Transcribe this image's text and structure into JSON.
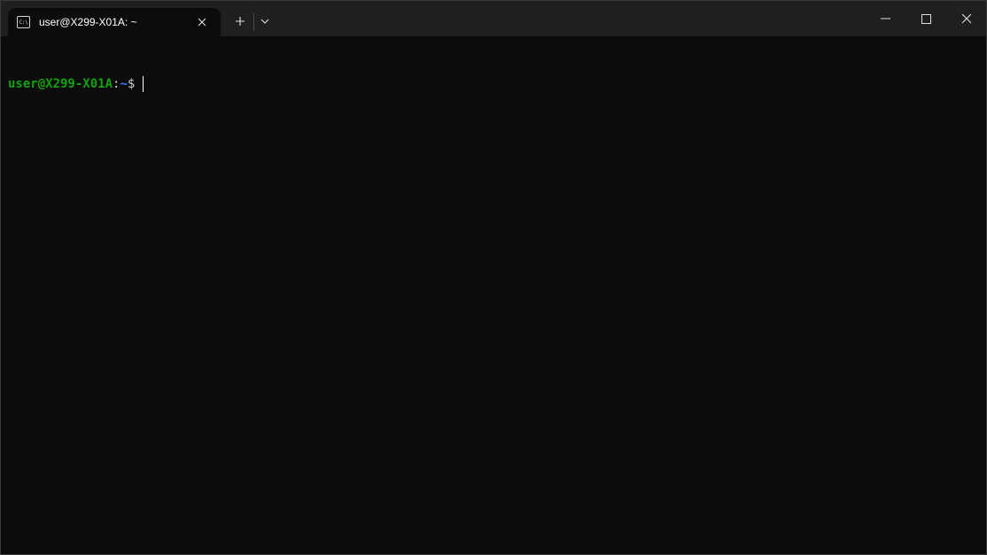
{
  "window": {
    "tab": {
      "title": "user@X299-X01A: ~",
      "icon": "terminal-icon",
      "icon_glyph": "C:\\"
    },
    "controls": {
      "new_tab_icon": "plus-icon",
      "dropdown_icon": "chevron-down-icon",
      "minimize_icon": "minimize-icon",
      "maximize_icon": "maximize-icon",
      "close_icon": "close-icon"
    }
  },
  "terminal": {
    "prompt": {
      "user_host": "user@X299-X01A",
      "colon": ":",
      "path": "~",
      "symbol": "$"
    }
  },
  "colors": {
    "background": "#0c0c0c",
    "titlebar": "#1f1f1f",
    "prompt_user": "#13a10e",
    "prompt_path": "#3b78ff",
    "text": "#cccccc"
  }
}
